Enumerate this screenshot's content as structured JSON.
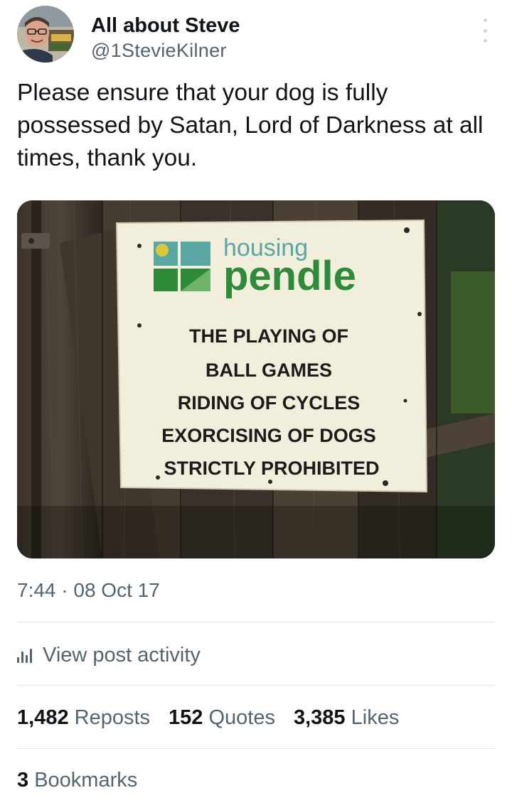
{
  "author": {
    "name": "All about Steve",
    "handle": "@1StevieKilner"
  },
  "post": {
    "text": "Please ensure that your dog is fully possessed by Satan, Lord of Darkness at all times, thank you.",
    "timestamp": "7:44 · 08 Oct 17"
  },
  "media": {
    "sign": {
      "brand_top": "housing",
      "brand_bottom": "pendle",
      "lines": [
        "THE PLAYING OF",
        "BALL GAMES",
        "RIDING OF CYCLES",
        "EXORCISING OF DOGS",
        "STRICTLY PROHIBITED"
      ]
    },
    "colors": {
      "brand_green": "#2e8b3a",
      "brand_teal": "#5aa6a3",
      "sign_bg": "#f1eedc"
    }
  },
  "activity": {
    "label": "View post activity",
    "icon": "analytics-bars-icon"
  },
  "stats": {
    "reposts": {
      "count": "1,482",
      "label": "Reposts"
    },
    "quotes": {
      "count": "152",
      "label": "Quotes"
    },
    "likes": {
      "count": "3,385",
      "label": "Likes"
    },
    "bookmarks": {
      "count": "3",
      "label": "Bookmarks"
    }
  },
  "colors": {
    "text_primary": "#0f1419",
    "text_secondary": "#536471",
    "divider": "#e1e6ea"
  }
}
